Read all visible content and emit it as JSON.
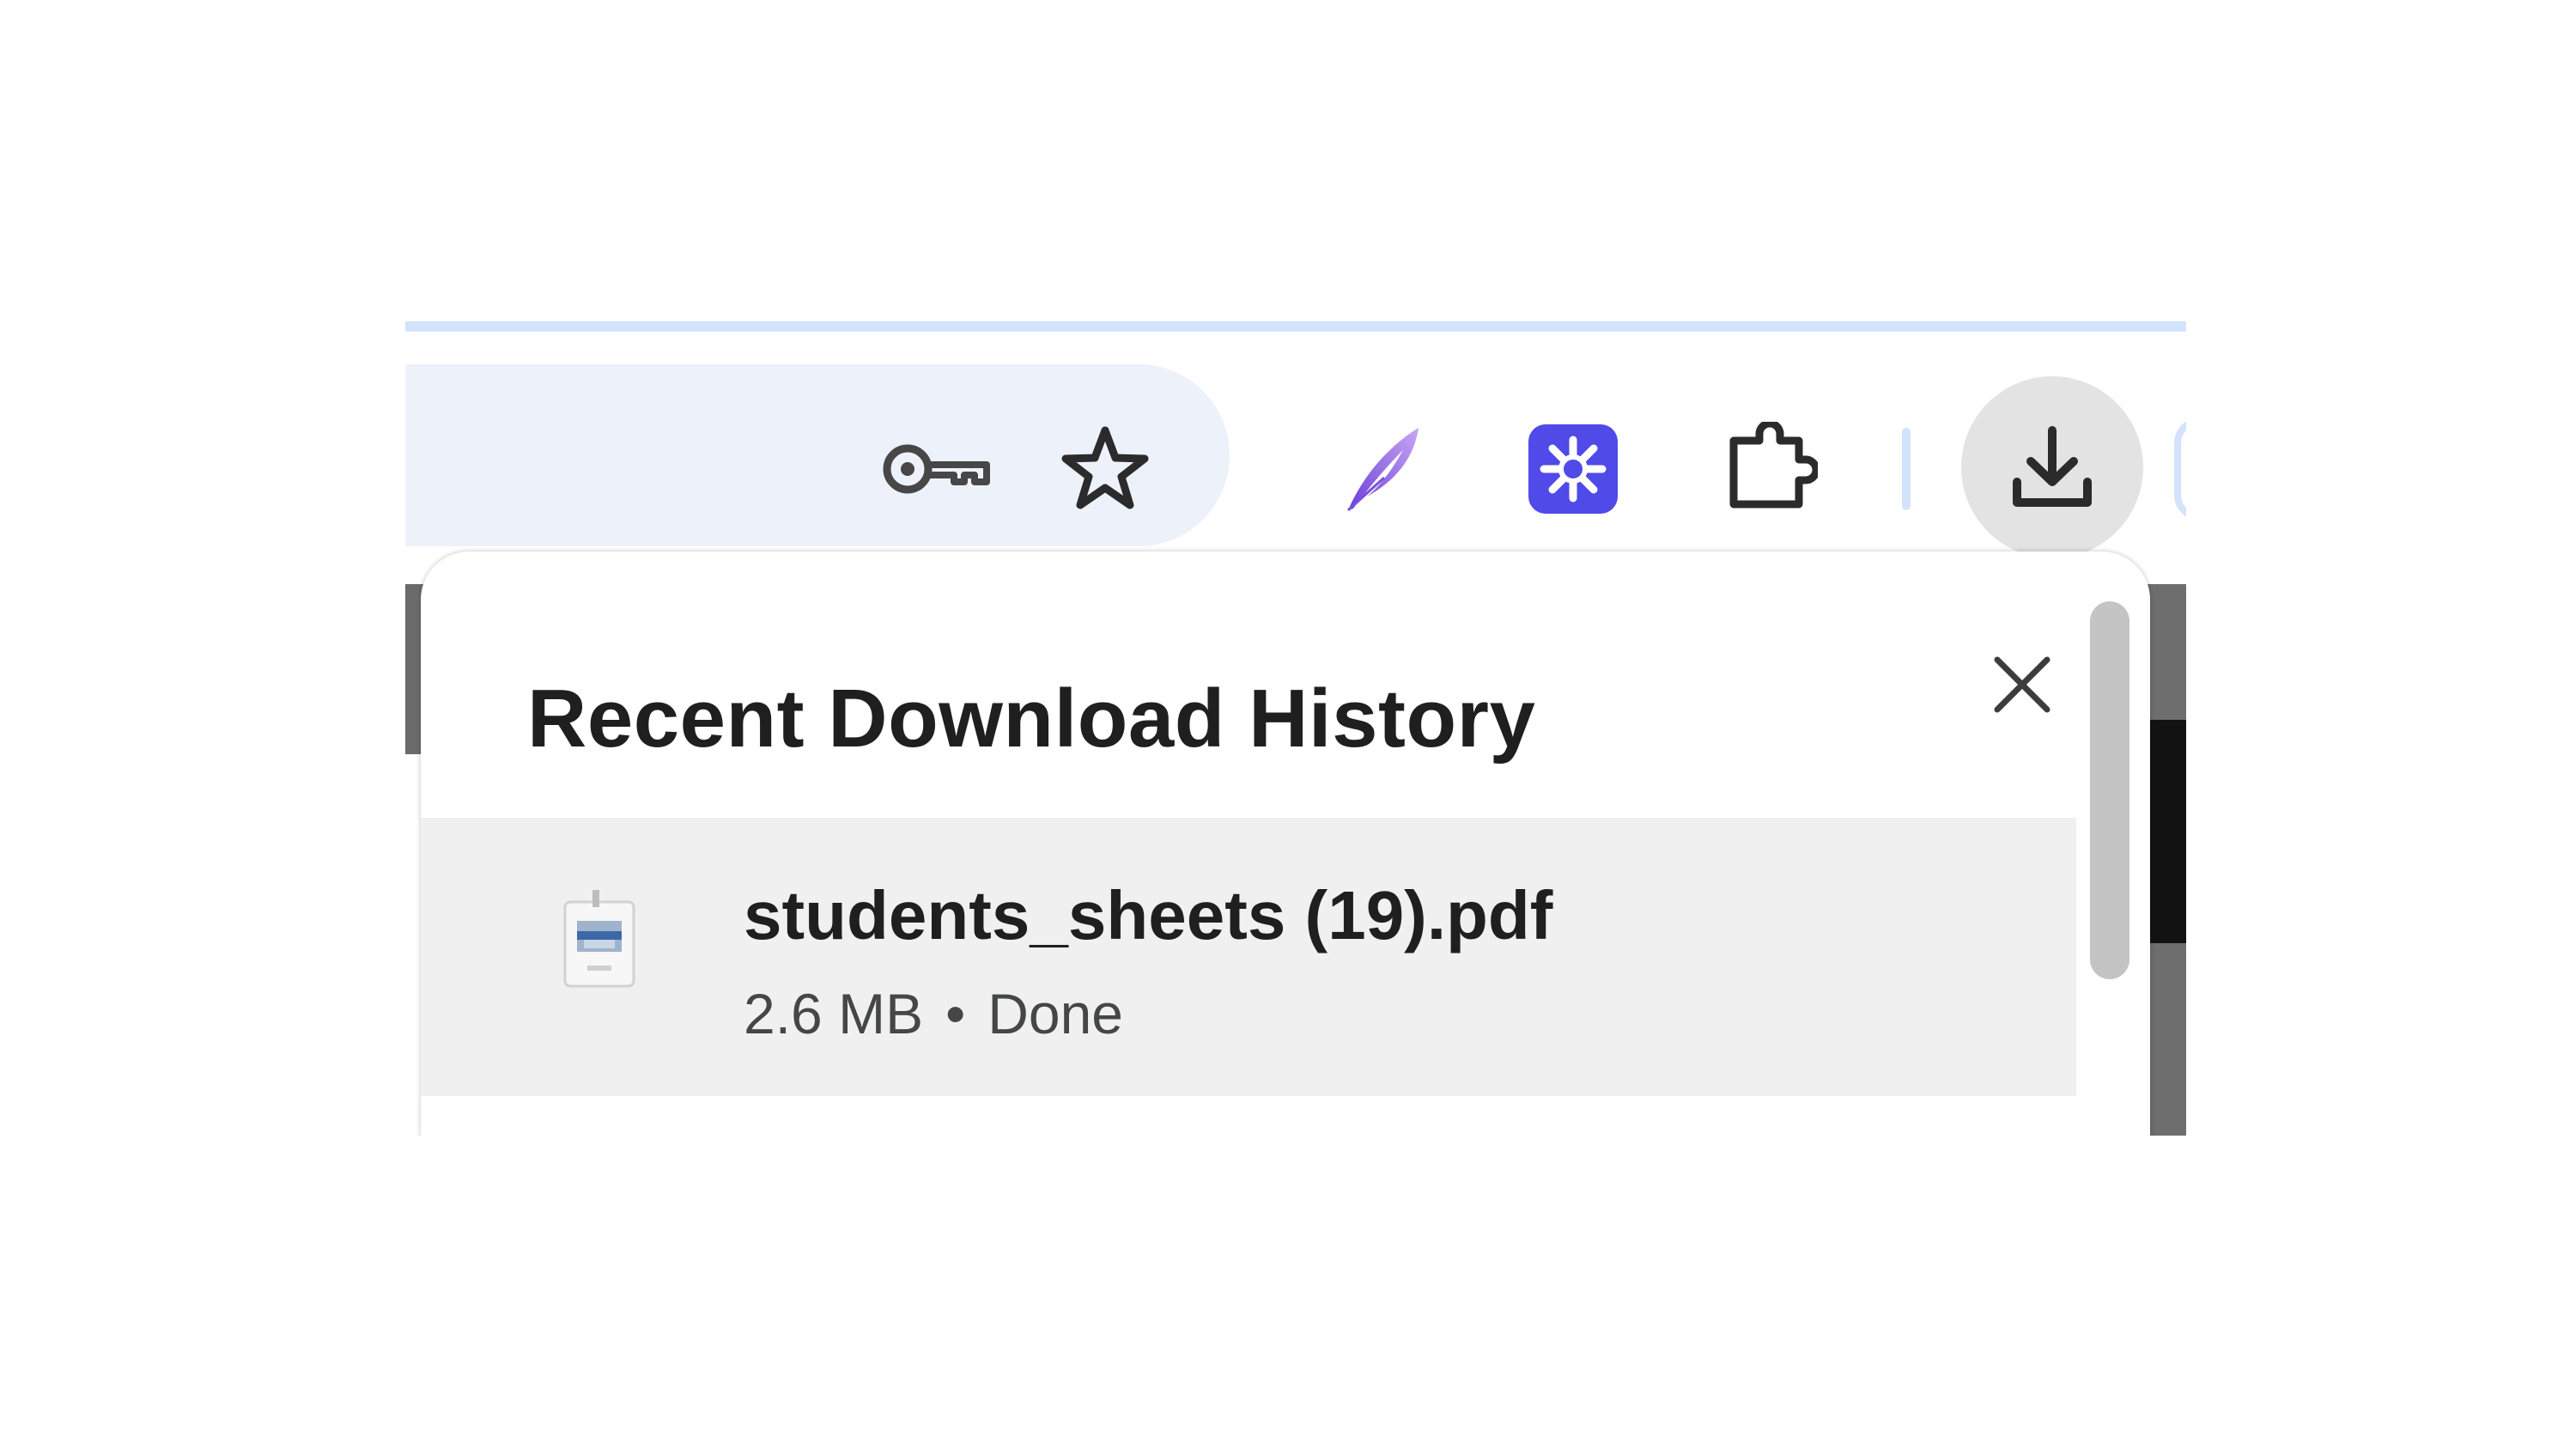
{
  "toolbar": {
    "icons": {
      "password": "key-icon",
      "bookmark": "star-icon",
      "extension_quill": "quill-icon",
      "extension_asterisk": "asterisk-icon",
      "extensions": "puzzle-icon",
      "downloads": "download-icon"
    },
    "colors": {
      "accent": "#d3e3fd",
      "omnibox": "#edf2fa",
      "download_active": "#e3e3e3",
      "asterisk_ext": "#4f4ae8"
    }
  },
  "popup": {
    "title": "Recent Download History",
    "close_icon": "close-icon",
    "items": [
      {
        "file_name": "students_sheets (19).pdf",
        "size": "2.6 MB",
        "separator": "•",
        "status": "Done",
        "icon": "pdf-file-icon"
      }
    ]
  }
}
